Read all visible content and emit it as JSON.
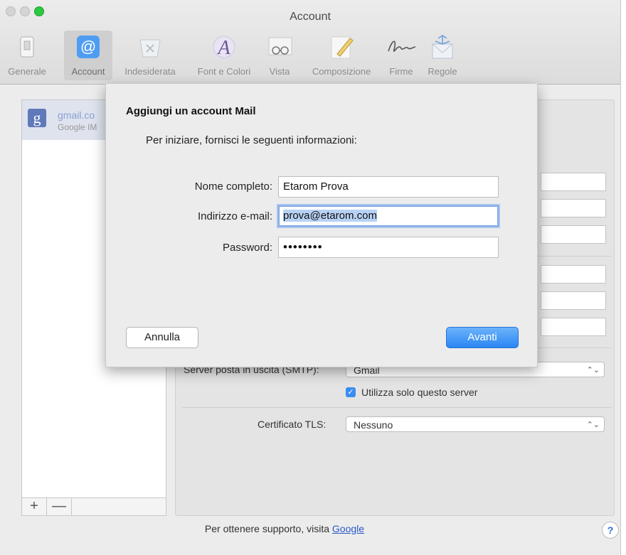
{
  "window": {
    "title": "Account"
  },
  "toolbar": {
    "items": [
      {
        "label": "Generale",
        "icon": "switch-icon"
      },
      {
        "label": "Account",
        "icon": "at-sign-icon",
        "selected": true
      },
      {
        "label": "Indesiderata",
        "icon": "junk-trash-icon"
      },
      {
        "label": "Font e Colori",
        "icon": "font-colors-icon"
      },
      {
        "label": "Vista",
        "icon": "glasses-icon"
      },
      {
        "label": "Composizione",
        "icon": "pencil-icon"
      },
      {
        "label": "Firme",
        "icon": "signature-icon"
      },
      {
        "label": "Regole",
        "icon": "rules-envelope-icon"
      }
    ]
  },
  "sidebar": {
    "account": {
      "name": "gmail.co",
      "type": "Google IM",
      "icon": "google-g-icon"
    },
    "add_label": "+",
    "remove_label": "—"
  },
  "panel": {
    "smtp_label": "Server posta in uscita (SMTP):",
    "smtp_value": "Gmail",
    "only_server_label": "Utilizza solo questo server",
    "only_server_checked": true,
    "tls_label": "Certificato TLS:",
    "tls_value": "Nessuno"
  },
  "footer": {
    "text": "Per ottenere supporto, visita",
    "link": "Google",
    "help": "?"
  },
  "sheet": {
    "title": "Aggiungi un account Mail",
    "subtitle": "Per iniziare, fornisci le seguenti informazioni:",
    "fields": {
      "name_label": "Nome completo:",
      "name_value": "Etarom Prova",
      "email_label": "Indirizzo e-mail:",
      "email_value": "prova@etarom.com",
      "password_label": "Password:",
      "password_value": "••••••••"
    },
    "cancel_label": "Annulla",
    "next_label": "Avanti"
  },
  "colors": {
    "accent": "#2a86f3",
    "selection": "#b8d2f6",
    "google_badge": "#5f79ba"
  }
}
